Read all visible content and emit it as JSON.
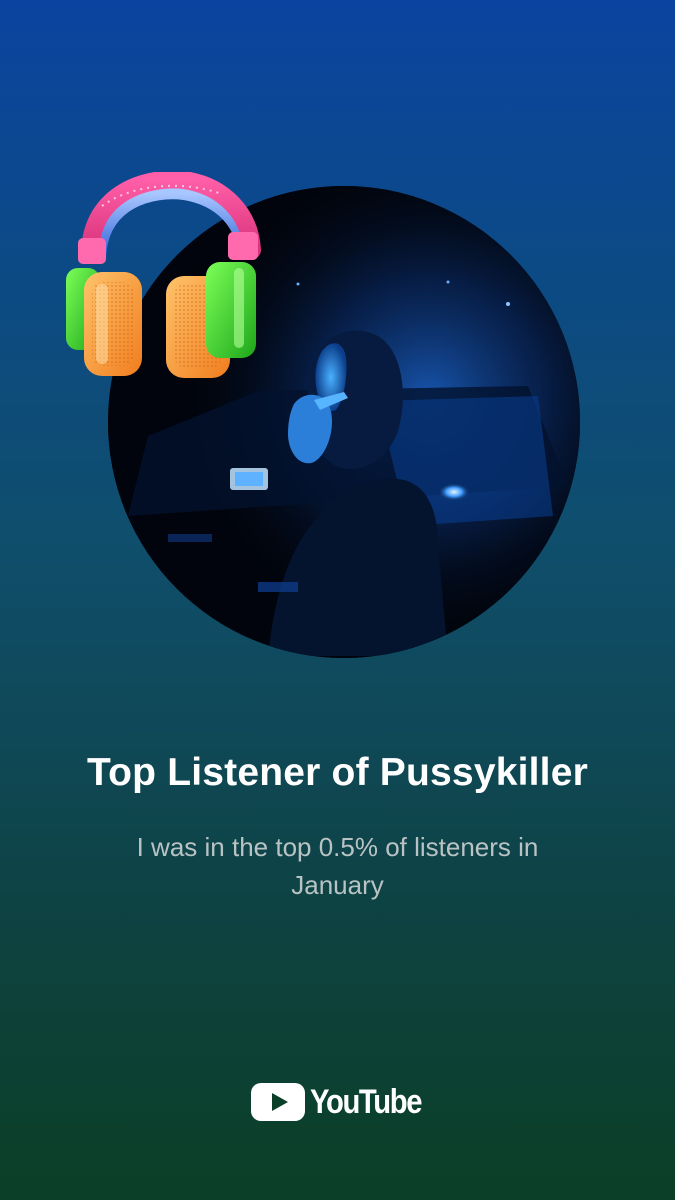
{
  "card": {
    "title": "Top Listener of Pussykiller",
    "subtitle": "I was in the top 0.5% of listeners in January"
  },
  "images": {
    "artist_photo": "artist-photo",
    "sticker": "headphones-sticker"
  },
  "brand": {
    "name": "YouTube",
    "icon": "youtube-play-icon"
  },
  "colors": {
    "gradient_top": "#0b44a0",
    "gradient_bottom": "#0b3f26",
    "title": "#ffffff",
    "subtitle": "#b9c3c4"
  }
}
